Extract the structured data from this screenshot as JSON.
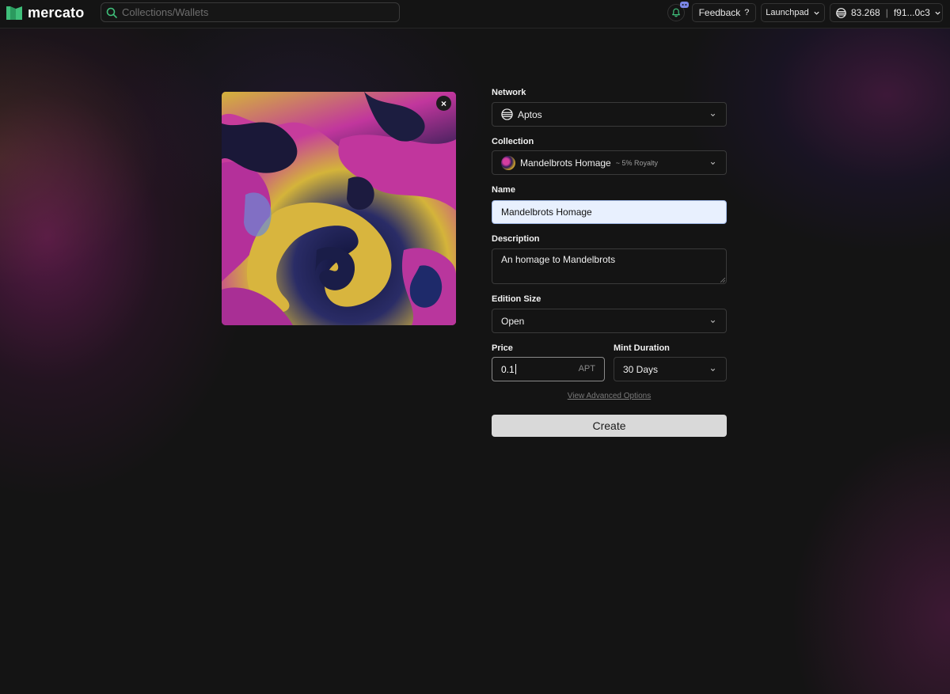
{
  "header": {
    "logo_text": "mercato",
    "search_placeholder": "Collections/Wallets",
    "feedback_label": "Feedback",
    "feedback_suffix": "?",
    "launchpad_label": "Launchpad",
    "wallet_balance": "83.268",
    "wallet_separator": "|",
    "wallet_address": "f91...0c3",
    "icons": [
      "search-icon",
      "bell-icon",
      "discord-icon",
      "chevron-down-icon",
      "aptos-icon"
    ]
  },
  "artwork": {
    "remove_label": "×"
  },
  "form": {
    "network": {
      "label": "Network",
      "value": "Aptos"
    },
    "collection": {
      "label": "Collection",
      "value": "Mandelbrots Homage",
      "royalty": "~ 5% Royalty"
    },
    "name": {
      "label": "Name",
      "value": "Mandelbrots Homage"
    },
    "description": {
      "label": "Description",
      "value": "An homage to Mandelbrots"
    },
    "edition_size": {
      "label": "Edition Size",
      "value": "Open"
    },
    "price": {
      "label": "Price",
      "value": "0.1",
      "unit": "APT"
    },
    "mint_duration": {
      "label": "Mint Duration",
      "value": "30 Days"
    },
    "advanced_link": "View Advanced Options",
    "create_label": "Create"
  },
  "colors": {
    "background": "#141414",
    "accent_green": "#3fbf7a",
    "button_bg": "#d9d9d9",
    "autofill_bg": "#e8f0fe"
  }
}
